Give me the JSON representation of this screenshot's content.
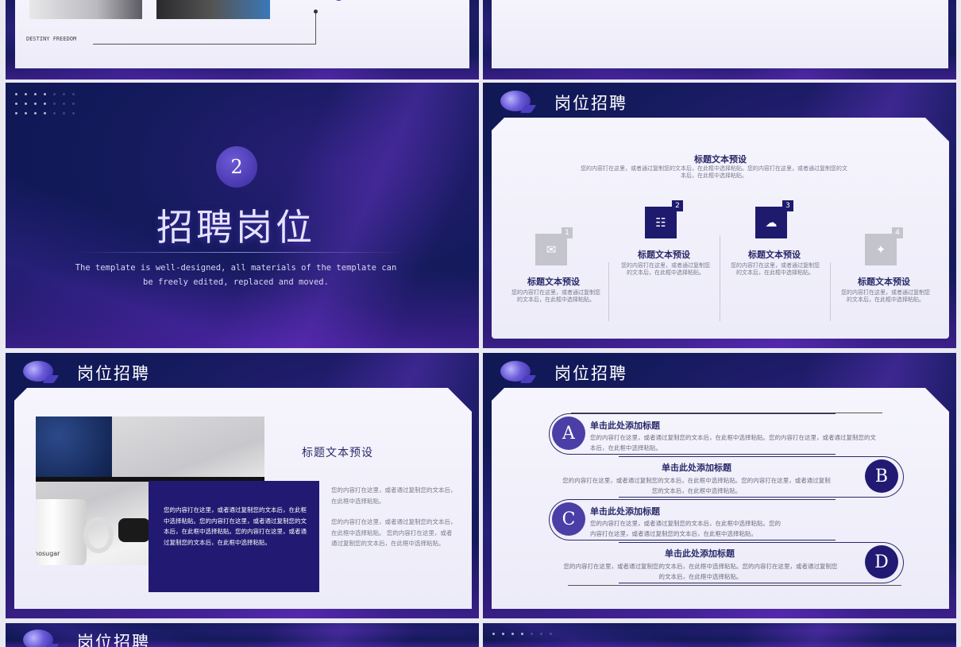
{
  "slide1": {
    "footer_text": "DESTINY  FREEDOM"
  },
  "slide_section": {
    "number": "2",
    "title": "招聘岗位",
    "subtitle_line1": "The template is well-designed, all materials of the template can",
    "subtitle_line2": "be freely edited, replaced and moved."
  },
  "slide_cards": {
    "header": "岗位招聘",
    "top_title": "标题文本预设",
    "top_text": "您的内容打在这里，或者通过复制您的文本后，在此框中选择粘贴。您的内容打在这里，或者通过复制您的文本后，在此框中选择粘贴。",
    "cards": [
      {
        "num": "1",
        "title": "标题文本预设",
        "text": "您的内容打在这里，或者通过复制您的文本后，在此框中选择粘贴。",
        "icon": "mail-icon",
        "glyph": "✉"
      },
      {
        "num": "2",
        "title": "标题文本预设",
        "text": "您的内容打在这里，或者通过复制您的文本后，在此框中选择粘贴。",
        "icon": "hierarchy-icon",
        "glyph": "☷"
      },
      {
        "num": "3",
        "title": "标题文本预设",
        "text": "您的内容打在这里，或者通过复制您的文本后，在此框中选择粘贴。",
        "icon": "cloud-wifi-icon",
        "glyph": "☁"
      },
      {
        "num": "4",
        "title": "标题文本预设",
        "text": "您的内容打在这里，或者通过复制您的文本后，在此框中选择粘贴。",
        "icon": "target-icon",
        "glyph": "✦"
      }
    ]
  },
  "slide_photo": {
    "header": "岗位招聘",
    "title": "标题文本预设",
    "box_text": "您的内容打在这里，或者通过复制您的文本后，在此框中选择粘贴。您的内容打在这里，或者通过复制您的文本后，在此框中选择粘贴。您的内容打在这里，或者通过复制您的文本后，在此框中选择粘贴。",
    "para1": "您的内容打在这里，或者通过复制您的文本后，在此框中选择粘贴。",
    "para2": "您的内容打在这里，或者通过复制您的文本后，在此框中选择粘贴。 您的内容打在这里，或者通过复制您的文本后，在此框中选择粘贴。",
    "cup_text": "nosugar"
  },
  "slide_list": {
    "header": "岗位招聘",
    "items": [
      {
        "letter": "A",
        "title": "单击此处添加标题",
        "text": "您的内容打在这里，或者通过复制您的文本后，在此框中选择粘贴。您的内容打在这里，或者通过复制您的文本后，在此框中选择粘贴。"
      },
      {
        "letter": "B",
        "title": "单击此处添加标题",
        "text": "您的内容打在这里，或者通过复制您的文本后，在此框中选择粘贴。您的内容打在这里，或者通过复制您的文本后，在此框中选择粘贴。"
      },
      {
        "letter": "C",
        "title": "单击此处添加标题",
        "text": "您的内容打在这里，或者通过复制您的文本后，在此框中选择粘贴。您的内容打在这里，或者通过复制您的文本后，在此框中选择粘贴。"
      },
      {
        "letter": "D",
        "title": "单击此处添加标题",
        "text": "您的内容打在这里，或者通过复制您的文本后，在此框中选择粘贴。您的内容打在这里，或者通过复制您的文本后，在此框中选择粘贴。"
      }
    ]
  },
  "colors": {
    "navy": "#1e1a6e",
    "accent": "#4b3ec0",
    "grey_icon": "#c4c4cc"
  }
}
